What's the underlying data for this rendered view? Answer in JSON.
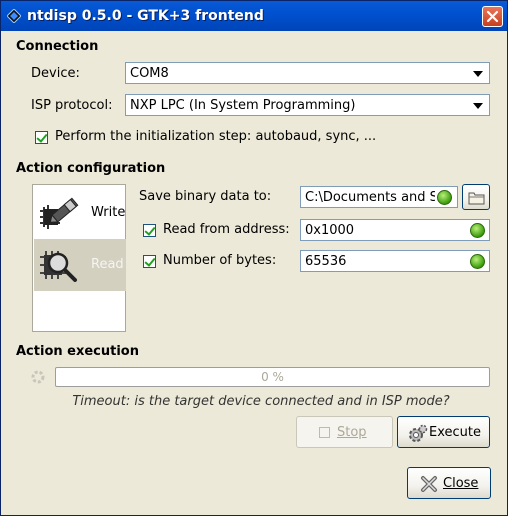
{
  "window": {
    "title": "ntdisp 0.5.0 - GTK+3 frontend"
  },
  "connection": {
    "section_title": "Connection",
    "device_label": "Device:",
    "device_value": "COM8",
    "isp_label": "ISP protocol:",
    "isp_value": "NXP LPC (In System Programming)",
    "init_step_label": "Perform the initialization step: autobaud, sync, ..."
  },
  "action_config": {
    "section_title": "Action configuration",
    "actions": [
      {
        "label": "Write",
        "icon": "chip-write-icon",
        "selected": false
      },
      {
        "label": "Read",
        "icon": "chip-read-icon",
        "selected": true
      }
    ],
    "save_label": "Save binary data to:",
    "save_value": "C:\\Documents and S",
    "read_from_label": "Read from address:",
    "read_from_value": "0x1000",
    "num_bytes_label": "Number of bytes:",
    "num_bytes_value": "65536"
  },
  "action_execution": {
    "section_title": "Action execution",
    "progress_text": "0 %",
    "progress_fraction": 0.0,
    "status_text": "Timeout: is the target device connected and in ISP mode?",
    "stop_label": "Stop",
    "execute_label": "Execute"
  },
  "footer": {
    "close_label": "Close"
  },
  "colors": {
    "titlebar": "#0054e3",
    "background": "#ece9d8",
    "led_ok": "#3b9b0b",
    "check": "#21a121"
  }
}
